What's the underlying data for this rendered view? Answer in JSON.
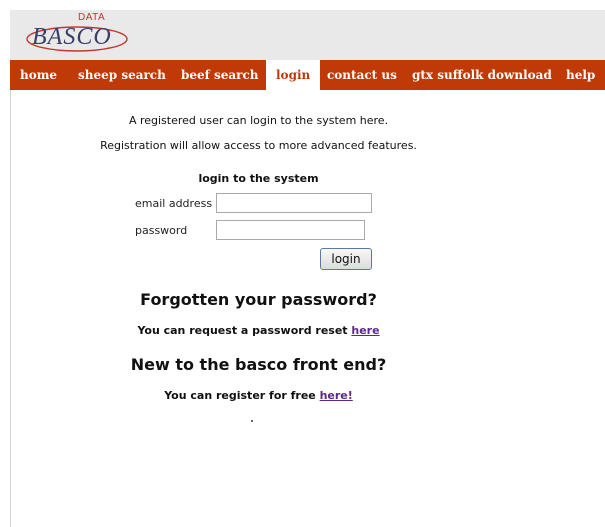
{
  "logo": {
    "data_text": "DATA",
    "word_text": "BASCO"
  },
  "nav": {
    "items": [
      {
        "label": "home"
      },
      {
        "label": "sheep search"
      },
      {
        "label": "beef search"
      },
      {
        "label": "login"
      },
      {
        "label": "contact us"
      },
      {
        "label": "gtx suffolk download"
      },
      {
        "label": "help"
      }
    ],
    "active_index": 3,
    "color": "#bf3a07"
  },
  "intro": {
    "line1": "A registered user can login to the system here.",
    "line2": "Registration will allow access to more advanced features."
  },
  "login_form": {
    "title": "login to the system",
    "email_label": "email address",
    "email_value": "",
    "password_label": "password",
    "password_value": "",
    "button_label": "login"
  },
  "forgot": {
    "heading": "Forgotten your password?",
    "text": "You can request a password reset ",
    "link_text": "here"
  },
  "register": {
    "heading": "New to the basco front end?",
    "text": "You can register for free ",
    "link_text": "here!"
  }
}
